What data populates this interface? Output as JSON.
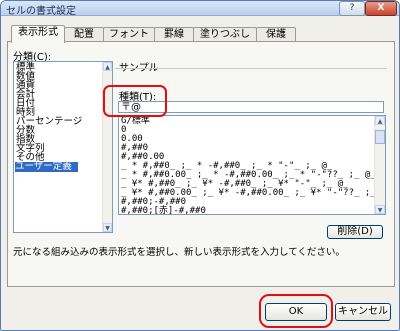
{
  "window": {
    "title": "セルの書式設定",
    "help_label": "?",
    "close_label": "X"
  },
  "tabs": [
    "表示形式",
    "配置",
    "フォント",
    "罫線",
    "塗りつぶし",
    "保護"
  ],
  "category": {
    "label": "分類(C):",
    "items": [
      "標準",
      "数値",
      "通貨",
      "会計",
      "日付",
      "時刻",
      "パーセンテージ",
      "分数",
      "指数",
      "文字列",
      "その他",
      "ユーザー定義"
    ],
    "selected_index": 11
  },
  "sample": {
    "label": "サンプル",
    "value": ""
  },
  "type": {
    "label": "種類(T):",
    "value": "〒@",
    "list_items": [
      "G/標準",
      "0",
      "0.00",
      "#,##0",
      "#,##0.00",
      "_ * #,##0_ ;_ * -#,##0_ ;_ * \"-\"_ ;_ @_",
      "_ * #,##0.00_ ;_ * -#,##0.00_ ;_ * \"-\"??_ ;_ @_",
      "_ ¥* #,##0_ ;_ ¥* -#,##0_ ;_ ¥* \"-\"_ ;_ @_",
      "_ ¥* #,##0.00_ ;_ ¥* -#,##0.00_ ;_ ¥* \"-\"??_ ;_ @_",
      "#,##0;-#,##0",
      "#,##0;[赤]-#,##0"
    ]
  },
  "delete_label": "削除(D)",
  "description": "元になる組み込みの表示形式を選択し、新しい表示形式を入力してください。",
  "ok_label": "OK",
  "cancel_label": "キャンセル"
}
